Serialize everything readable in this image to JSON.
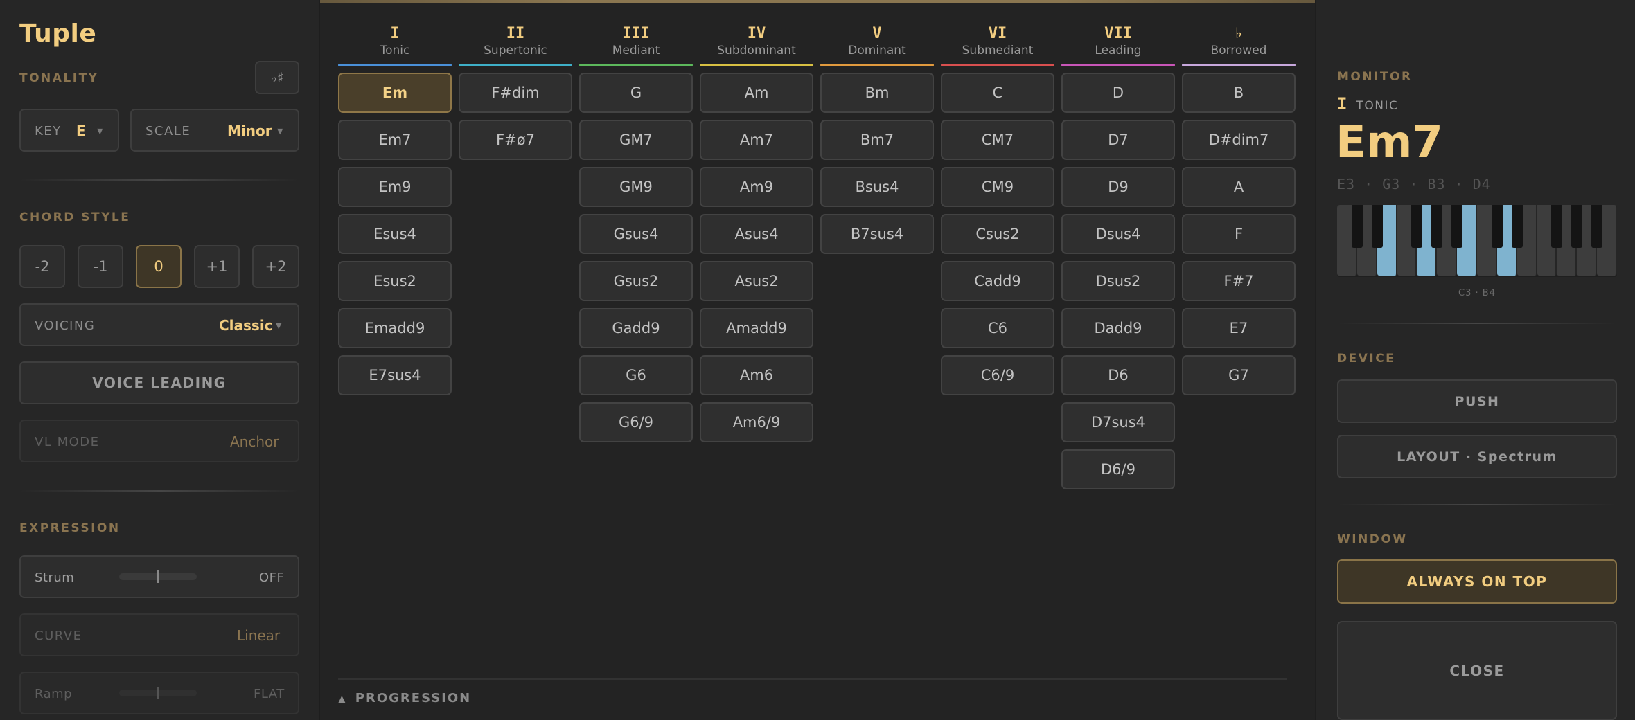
{
  "app": {
    "title": "Tuple"
  },
  "tonality": {
    "section_label": "TONALITY",
    "accidental_toggle": "♭♯",
    "key_label": "KEY",
    "key_value": "E",
    "scale_label": "SCALE",
    "scale_value": "Minor"
  },
  "chord_style": {
    "section_label": "CHORD STYLE",
    "octave_options": [
      "-2",
      "-1",
      "0",
      "+1",
      "+2"
    ],
    "octave_selected": "0",
    "voicing_label": "VOICING",
    "voicing_value": "Classic",
    "voice_leading_label": "VOICE LEADING",
    "vl_mode_label": "VL MODE",
    "vl_mode_value": "Anchor"
  },
  "expression": {
    "section_label": "EXPRESSION",
    "strum_label": "Strum",
    "strum_value": "OFF",
    "strum_level": 0.5,
    "curve_label": "CURVE",
    "curve_value": "Linear",
    "ramp_label": "Ramp",
    "ramp_value": "FLAT",
    "ramp_level": 0.5
  },
  "grid": {
    "columns": [
      {
        "numeral": "I",
        "name": "Tonic",
        "color": "#4a90d9",
        "chords": [
          "Em",
          "Em7",
          "Em9",
          "Esus4",
          "Esus2",
          "Emadd9",
          "E7sus4"
        ]
      },
      {
        "numeral": "II",
        "name": "Supertonic",
        "color": "#3fb0c8",
        "chords": [
          "F#dim",
          "F#ø7"
        ]
      },
      {
        "numeral": "III",
        "name": "Mediant",
        "color": "#5db85c",
        "chords": [
          "G",
          "GM7",
          "GM9",
          "Gsus4",
          "Gsus2",
          "Gadd9",
          "G6",
          "G6/9"
        ]
      },
      {
        "numeral": "IV",
        "name": "Subdominant",
        "color": "#d8c043",
        "chords": [
          "Am",
          "Am7",
          "Am9",
          "Asus4",
          "Asus2",
          "Amadd9",
          "Am6",
          "Am6/9"
        ]
      },
      {
        "numeral": "V",
        "name": "Dominant",
        "color": "#e19a3e",
        "chords": [
          "Bm",
          "Bm7",
          "Bsus4",
          "B7sus4"
        ]
      },
      {
        "numeral": "VI",
        "name": "Submediant",
        "color": "#d94f4f",
        "chords": [
          "C",
          "CM7",
          "CM9",
          "Csus2",
          "Cadd9",
          "C6",
          "C6/9"
        ]
      },
      {
        "numeral": "VII",
        "name": "Leading",
        "color": "#c956b8",
        "chords": [
          "D",
          "D7",
          "D9",
          "Dsus4",
          "Dsus2",
          "Dadd9",
          "D6",
          "D7sus4",
          "D6/9"
        ]
      },
      {
        "numeral": "♭",
        "name": "Borrowed",
        "color": "#c7a8dc",
        "chords": [
          "B",
          "D#dim7",
          "A",
          "F",
          "F#7",
          "E7",
          "G7"
        ]
      }
    ],
    "active_chord": "Em",
    "progression_label": "PROGRESSION",
    "progression_arrow": "▲"
  },
  "monitor": {
    "section_label": "MONITOR",
    "degree_numeral": "I",
    "degree_name": "TONIC",
    "chord_name": "Em7",
    "notes_text": "E3 · G3 · B3 · D4",
    "range_text": "C3 · B4",
    "highlight_color": "#7fb3cf"
  },
  "device": {
    "section_label": "DEVICE",
    "push_label": "PUSH",
    "layout_label": "LAYOUT · Spectrum"
  },
  "window": {
    "section_label": "WINDOW",
    "always_on_top_label": "ALWAYS ON TOP",
    "close_label": "CLOSE"
  }
}
